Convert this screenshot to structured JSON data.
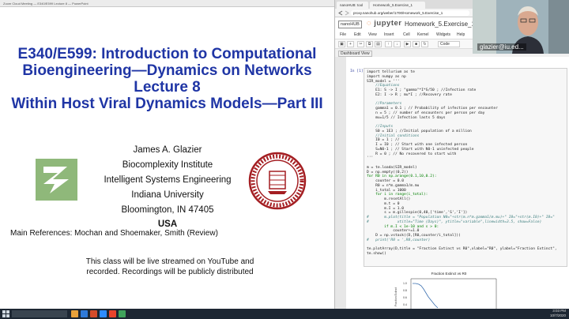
{
  "slide": {
    "window_title": "Zoom Cloud Meeting — E340/E599 Lecture 8 — PowerPoint",
    "title_lines": [
      "E340/E599: Introduction to Computational",
      "Bioengineering—Dynamics on Networks",
      "Lecture 8",
      "Within Host Viral Dynamics Models—Part III"
    ],
    "author_lines": [
      "James  A. Glazier",
      "Biocomplexity Institute",
      "Intelligent Systems Engineering",
      "Indiana University",
      "Bloomington, IN 47405"
    ],
    "country": "USA",
    "references": "Main References: Mochan and Shoemaker, Smith (Review)",
    "note_lines": [
      "This class will be live streamed on YouTube and",
      "recorded. Recordings will be publicly distributed"
    ]
  },
  "browser": {
    "tabs": [
      "nanoHUB: tool",
      "Homework_5.Exercise_1"
    ],
    "url": "proxy.nanohub.org/weber/1700/Homework_5.Exercise_1",
    "nanohub_logo": "nanoHUB",
    "jupyter_logo": "jupyter",
    "notebook_title": "Homework_5.Exercise_1",
    "menu": [
      "File",
      "Edit",
      "View",
      "Insert",
      "Cell",
      "Kernel",
      "Widgets",
      "Help"
    ],
    "cell_type": "Code",
    "dashboard_label": "Dashboard View",
    "cell_prompt": "In [1]:",
    "code_lines": [
      {
        "text": "import tellurium as te",
        "kind": "code"
      },
      {
        "text": "import numpy as np",
        "kind": "code"
      },
      {
        "text": "SIR_model = '''",
        "kind": "code"
      },
      {
        "text": "    //Equations",
        "kind": "comment"
      },
      {
        "text": "    E1: S -> I ; \"gamma\"*I*S/50 ; //Infection rate",
        "kind": "code"
      },
      {
        "text": "    E2: I -> R ; mu*I ; //Recovery rate",
        "kind": "code"
      },
      {
        "text": "",
        "kind": "code"
      },
      {
        "text": "    //Parameters",
        "kind": "comment"
      },
      {
        "text": "    gamma1 = 0.1 ; // Probability of infection per encounter",
        "kind": "code"
      },
      {
        "text": "    n = 5 ; // number of encounters per person per day",
        "kind": "code"
      },
      {
        "text": "    mu=1/5 // Infection lasts 5 days",
        "kind": "code"
      },
      {
        "text": "",
        "kind": "code"
      },
      {
        "text": "    //Inputs",
        "kind": "comment"
      },
      {
        "text": "    S0 = 1E3 ; //Initial population of a million",
        "kind": "code"
      },
      {
        "text": "    //Initial conditions",
        "kind": "comment"
      },
      {
        "text": "    I0 = 1 ; //",
        "kind": "code"
      },
      {
        "text": "    I = I0 ; // Start with one infected person",
        "kind": "code"
      },
      {
        "text": "    S=N0-1 ; // Start with N0-1 uninfected people",
        "kind": "code"
      },
      {
        "text": "    R = 0 ; // No recovered to start with",
        "kind": "code"
      },
      {
        "text": "'''",
        "kind": "code"
      },
      {
        "text": "",
        "kind": "code"
      },
      {
        "text": "m = te.loada(SIR_model)",
        "kind": "code"
      },
      {
        "text": "D = np.empty((0,2))",
        "kind": "code"
      },
      {
        "text": "for R0 in np.arange(0.1,10,0.2):",
        "kind": "kw"
      },
      {
        "text": "    counter = 0.0",
        "kind": "code"
      },
      {
        "text": "    R0 = n*m.gamma1/m.mu",
        "kind": "code"
      },
      {
        "text": "    i_total = 1000",
        "kind": "code"
      },
      {
        "text": "    for i in range(i_total):",
        "kind": "kw"
      },
      {
        "text": "        m.resetAll()",
        "kind": "code"
      },
      {
        "text": "        m.t = 0",
        "kind": "code"
      },
      {
        "text": "        m.I = 1.0",
        "kind": "code"
      },
      {
        "text": "        s = m.gillespie(0,40,['time','S','I'])",
        "kind": "code"
      },
      {
        "text": "#       m.plot(title = \"Population N0=\"+str(m.n*m.gamma1/m.mu)+\" I0=\"+str(m.I0)+\" I0=\"",
        "kind": "comment"
      },
      {
        "text": "#             xtitle=\"Time (Days)\", ytitle=\"variable\",linewidth=3.5, show=False)",
        "kind": "comment"
      },
      {
        "text": "        if m.I < 1e-10 and s > 0:",
        "kind": "kw"
      },
      {
        "text": "            counter+=1.0",
        "kind": "code"
      },
      {
        "text": "    D = np.vstack((D,[R0,counter/i_total]))",
        "kind": "code"
      },
      {
        "text": "#   print('R0 = ',R0,counter)",
        "kind": "comment"
      },
      {
        "text": "",
        "kind": "code"
      },
      {
        "text": "te.plotArray(D,title = \"Fraction Extinct vs R0\",xlabel=\"R0\", ylabel=\"Fraction Extinct\",",
        "kind": "code"
      },
      {
        "text": "te.show()",
        "kind": "code"
      }
    ],
    "plot_title": "Fraction Extinct vs R0",
    "plot_ylabel": "Fraction Extinct",
    "plot_yticks": [
      "1.0",
      "0.8",
      "0.6",
      "0.4"
    ]
  },
  "video": {
    "participant_name": "glazier@iu.ed..."
  },
  "taskbar": {
    "time": "3:03 PM",
    "date": "10/7/2020"
  }
}
